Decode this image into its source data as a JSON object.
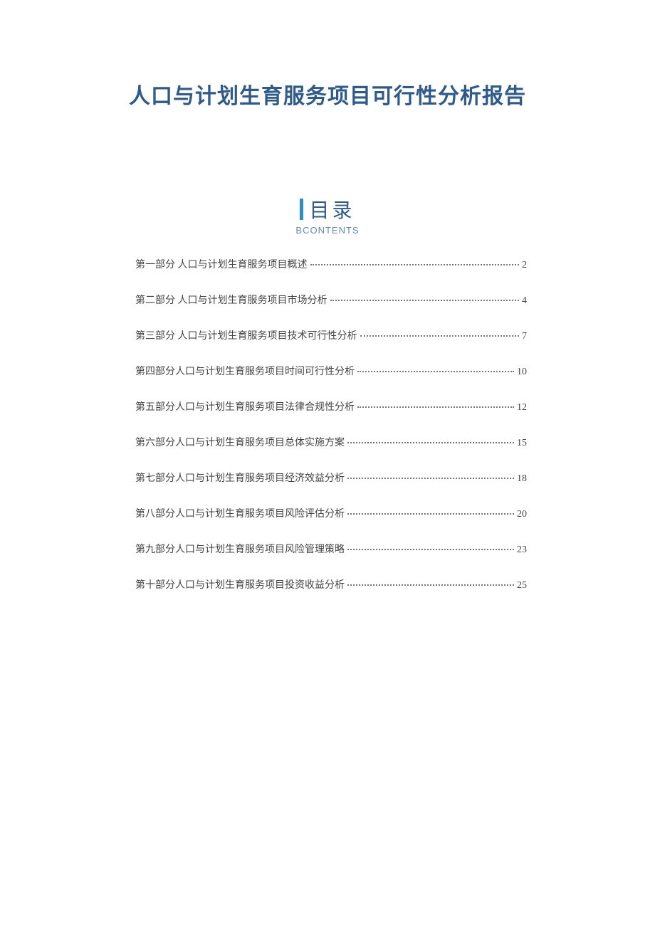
{
  "title": "人口与计划生育服务项目可行性分析报告",
  "toc_heading": {
    "title": "目录",
    "subtitle": "BCONTENTS"
  },
  "toc": [
    {
      "label": "第一部分  人口与计划生育服务项目概述",
      "page": "2"
    },
    {
      "label": "第二部分  人口与计划生育服务项目市场分析",
      "page": "4"
    },
    {
      "label": "第三部分  人口与计划生育服务项目技术可行性分析",
      "page": "7"
    },
    {
      "label": "第四部分人口与计划生育服务项目时间可行性分析",
      "page": "10"
    },
    {
      "label": "第五部分人口与计划生育服务项目法律合规性分析",
      "page": "12"
    },
    {
      "label": "第六部分人口与计划生育服务项目总体实施方案",
      "page": "15"
    },
    {
      "label": "第七部分人口与计划生育服务项目经济效益分析",
      "page": "18"
    },
    {
      "label": "第八部分人口与计划生育服务项目风险评估分析",
      "page": "20"
    },
    {
      "label": "第九部分人口与计划生育服务项目风险管理策略",
      "page": "23"
    },
    {
      "label": "第十部分人口与计划生育服务项目投资收益分析",
      "page": "25"
    }
  ]
}
